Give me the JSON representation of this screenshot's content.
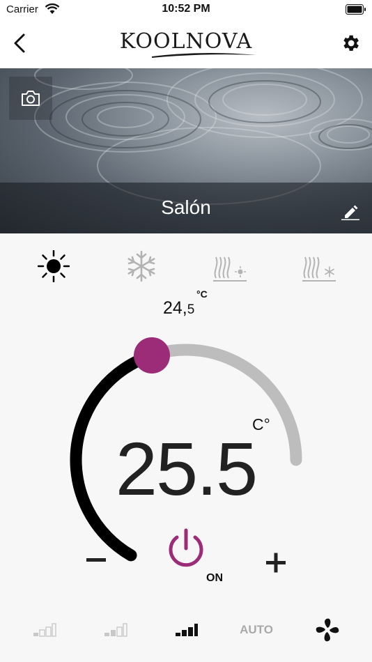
{
  "status": {
    "carrier": "Carrier",
    "time": "10:52 PM"
  },
  "nav": {
    "logo": "KOOLNOVA"
  },
  "zone": {
    "name": "Salón"
  },
  "modes": [
    {
      "name": "heat",
      "icon": "sun-icon",
      "active": true
    },
    {
      "name": "cool",
      "icon": "snowflake-icon",
      "active": false
    },
    {
      "name": "floor-heat",
      "icon": "radiant-heat-icon",
      "active": false
    },
    {
      "name": "floor-cool",
      "icon": "radiant-cool-icon",
      "active": false
    }
  ],
  "current": {
    "whole": "24,",
    "fraction": "5",
    "unit": "°C"
  },
  "setpoint": {
    "value": "25.5",
    "unit": "C°",
    "level": 0.55,
    "min_label": "−",
    "max_label": "+"
  },
  "power": {
    "state": "ON"
  },
  "fan": {
    "auto_label": "AUTO",
    "speeds": [
      "low",
      "medium",
      "high",
      "auto",
      "fan"
    ],
    "selected": "high"
  },
  "colors": {
    "accent": "#9c2b78",
    "arc_active": "#000000",
    "arc_inactive": "#bdbdbd"
  }
}
